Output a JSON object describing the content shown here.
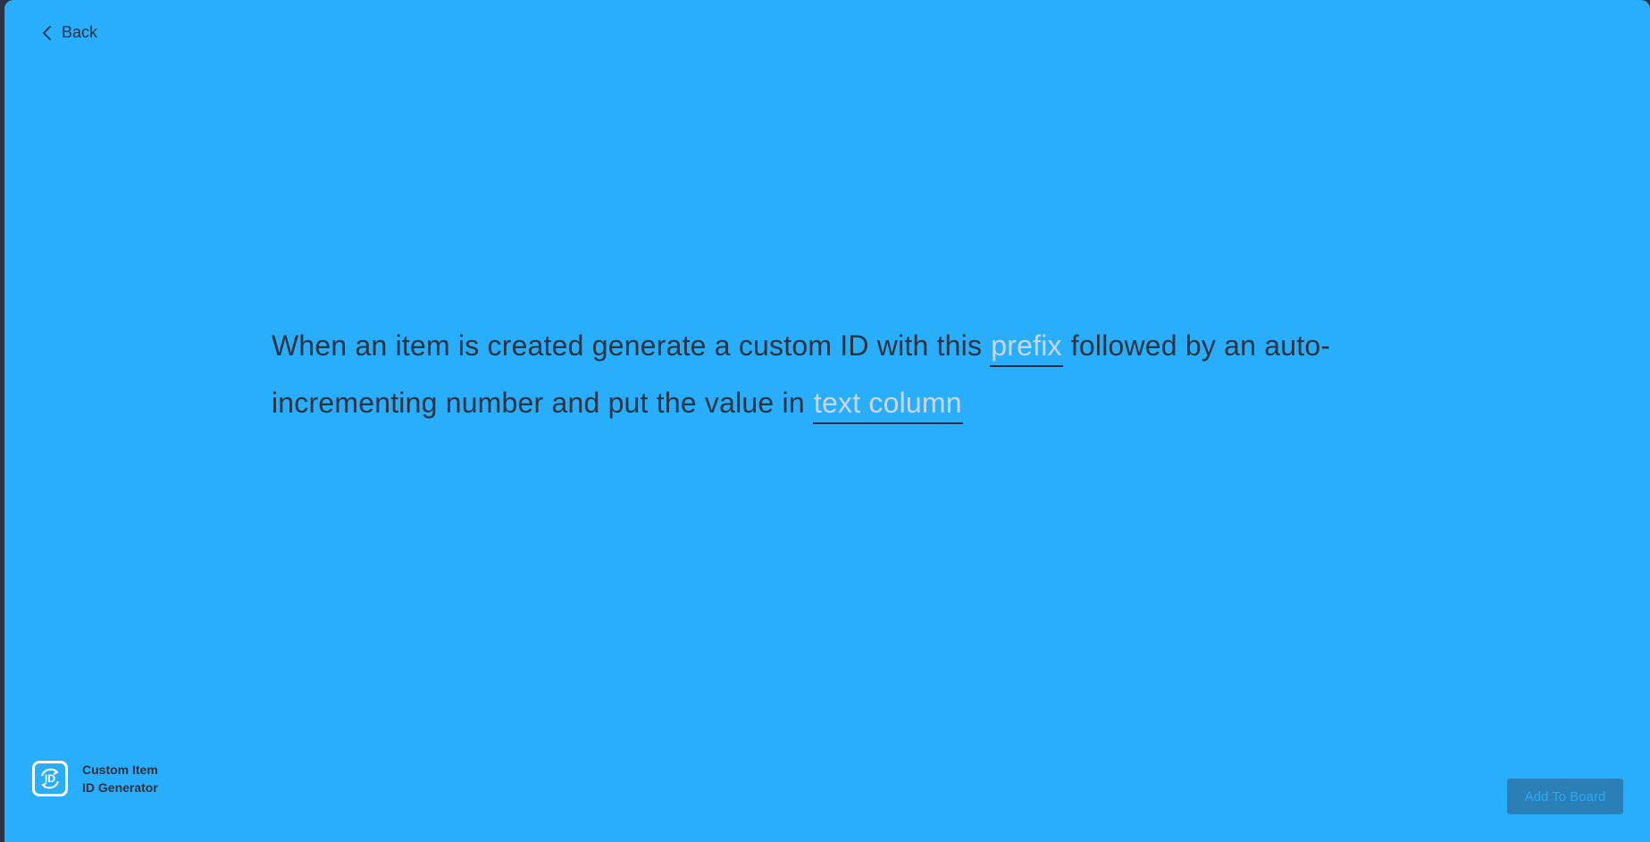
{
  "colors": {
    "background": "#29aefe",
    "text": "#2e3340",
    "field_text": "#cdd5e4",
    "button_bg": "#2a7fb6",
    "button_text": "#2aa9f5"
  },
  "header": {
    "back_label": "Back"
  },
  "recipe": {
    "part1": "When an item is created generate a custom ID with this ",
    "field_prefix": "prefix",
    "part2": " followed by an auto-incrementing number and put the value in ",
    "field_column": "text column"
  },
  "app": {
    "name_line1": "Custom Item",
    "name_line2": "ID Generator",
    "logo_text": "ID"
  },
  "footer": {
    "add_button_label": "Add To Board"
  }
}
